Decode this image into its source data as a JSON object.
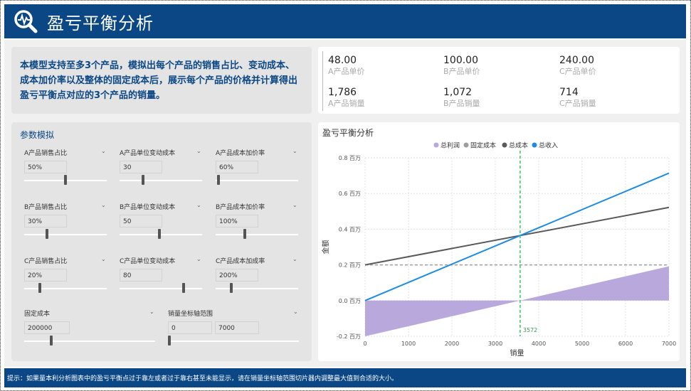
{
  "header": {
    "title": "盈亏平衡分析",
    "icon": "chart-magnifier-icon"
  },
  "description": {
    "text": "本模型支持至多3个产品，模拟出每个产品的销售占比、变动成本、成本加价率以及整体的固定成本后，展示每个产品的价格并计算得出盈亏平衡点对应的3个产品的销量。"
  },
  "kpis": [
    {
      "value": "48.00",
      "label": "A产品单价"
    },
    {
      "value": "100.00",
      "label": "B产品单价"
    },
    {
      "value": "240.00",
      "label": "C产品单价"
    },
    {
      "value": "1,786",
      "label": "A产品销量"
    },
    {
      "value": "1,072",
      "label": "B产品销量"
    },
    {
      "value": "714",
      "label": "C产品销量"
    }
  ],
  "params": {
    "title": "参数模拟",
    "slicers": [
      {
        "label": "A产品销售占比",
        "value": "50%",
        "fraction": 0.5
      },
      {
        "label": "A产品单位变动成本",
        "value": "30",
        "fraction": 0.28
      },
      {
        "label": "A产品成本加价率",
        "value": "60%",
        "fraction": 0.02
      },
      {
        "label": "B产品销售占比",
        "value": "30%",
        "fraction": 0.27
      },
      {
        "label": "B产品单位变动成本",
        "value": "50",
        "fraction": 0.48
      },
      {
        "label": "B产品成本加价率",
        "value": "100%",
        "fraction": 0.35
      },
      {
        "label": "C产品销售占比",
        "value": "20%",
        "fraction": 0.18
      },
      {
        "label": "C产品单位变动成本",
        "value": "80",
        "fraction": 0.79
      },
      {
        "label": "C产品成本加成率",
        "value": "200%",
        "fraction": 0.18
      }
    ],
    "fixed_cost": {
      "label": "固定成本",
      "value": "200000",
      "fraction": 0.2
    },
    "axis_range": {
      "label": "销量坐标轴范围",
      "min": "0",
      "max": "7000",
      "fraction": 0.0
    }
  },
  "chart": {
    "title": "盈亏平衡分析"
  },
  "chart_data": {
    "type": "line",
    "title": "盈亏平衡分析",
    "xlabel": "销量",
    "ylabel": "金额",
    "xlim": [
      0,
      7000
    ],
    "ylim": [
      -0.2,
      0.8
    ],
    "x_ticks": [
      "0",
      "1000",
      "2000",
      "3000",
      "4000",
      "5000",
      "6000",
      "7000"
    ],
    "y_ticks": [
      "-0.2 百万",
      "0.0 百万",
      "0.2 百万",
      "0.4 百万",
      "0.6 百万",
      "0.8 百万"
    ],
    "legend": [
      "总利润",
      "固定成本",
      "总成本",
      "总收入"
    ],
    "legend_position": "top-center",
    "grid": true,
    "breakeven": {
      "x": 3572,
      "label": "3572"
    },
    "series": [
      {
        "name": "总利润",
        "type": "area",
        "color": "#b9a8dc",
        "x": [
          0,
          7000
        ],
        "y": [
          -0.2,
          0.192
        ]
      },
      {
        "name": "固定成本",
        "type": "line",
        "dash": true,
        "color": "#9e9e9e",
        "x": [
          0,
          7000
        ],
        "y": [
          0.2,
          0.2
        ]
      },
      {
        "name": "总成本",
        "type": "line",
        "color": "#5a5a5a",
        "x": [
          0,
          7000
        ],
        "y": [
          0.2,
          0.522
        ]
      },
      {
        "name": "总收入",
        "type": "line",
        "color": "#1e8be6",
        "x": [
          0,
          7000
        ],
        "y": [
          0,
          0.714
        ]
      }
    ]
  },
  "footer": {
    "text": "提示：如果量本利分析图表中的盈亏平衡点过于靠左或者过于靠右甚至未能显示，请在销量坐标轴范围切片器内调整最大值到合适的大小。"
  }
}
